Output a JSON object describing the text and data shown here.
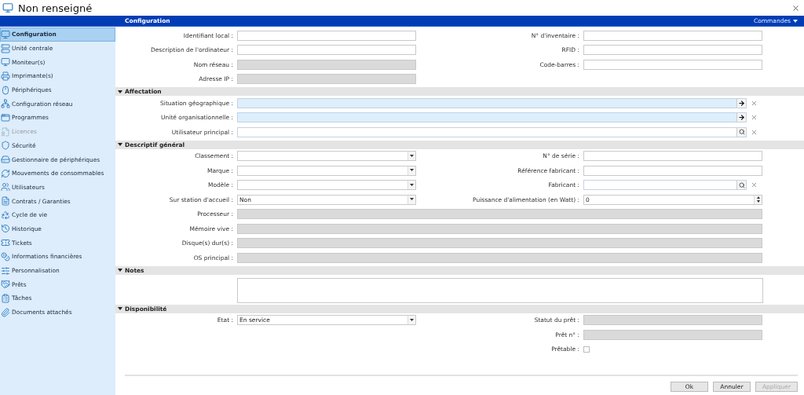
{
  "window": {
    "title": "Non renseigné"
  },
  "sidebar": {
    "items": [
      {
        "label": "Configuration",
        "selected": true,
        "disabled": false
      },
      {
        "label": "Unité centrale",
        "selected": false,
        "disabled": false
      },
      {
        "label": "Moniteur(s)",
        "selected": false,
        "disabled": false
      },
      {
        "label": "Imprimante(s)",
        "selected": false,
        "disabled": false
      },
      {
        "label": "Périphériques",
        "selected": false,
        "disabled": false
      },
      {
        "label": "Configuration réseau",
        "selected": false,
        "disabled": false
      },
      {
        "label": "Programmes",
        "selected": false,
        "disabled": false
      },
      {
        "label": "Licences",
        "selected": false,
        "disabled": true
      },
      {
        "label": "Sécurité",
        "selected": false,
        "disabled": false
      },
      {
        "label": "Gestionnaire de périphériques",
        "selected": false,
        "disabled": false
      },
      {
        "label": "Mouvements de consommables",
        "selected": false,
        "disabled": false
      },
      {
        "label": "Utilisateurs",
        "selected": false,
        "disabled": false
      },
      {
        "label": "Contrats / Garanties",
        "selected": false,
        "disabled": false
      },
      {
        "label": "Cycle de vie",
        "selected": false,
        "disabled": false
      },
      {
        "label": "Historique",
        "selected": false,
        "disabled": false
      },
      {
        "label": "Tickets",
        "selected": false,
        "disabled": false
      },
      {
        "label": "Informations financières",
        "selected": false,
        "disabled": false
      },
      {
        "label": "Personnalisation",
        "selected": false,
        "disabled": false
      },
      {
        "label": "Prêts",
        "selected": false,
        "disabled": false
      },
      {
        "label": "Tâches",
        "selected": false,
        "disabled": false
      },
      {
        "label": "Documents attachés",
        "selected": false,
        "disabled": false
      }
    ]
  },
  "header": {
    "title": "Configuration",
    "commands": "Commandes"
  },
  "main_rows": [
    {
      "left": {
        "label": "Identifiant local :",
        "kind": "text"
      },
      "right": {
        "label": "N° d'inventaire :",
        "kind": "text"
      }
    },
    {
      "left": {
        "label": "Description de l'ordinateur :",
        "kind": "text"
      },
      "right": {
        "label": "RFID :",
        "kind": "text"
      }
    },
    {
      "left": {
        "label": "Nom réseau :",
        "kind": "disabled"
      },
      "right": {
        "label": "Code-barres :",
        "kind": "text"
      }
    },
    {
      "left": {
        "label": "Adresse IP :",
        "kind": "disabled"
      }
    }
  ],
  "sections": [
    {
      "title": "Affectation",
      "expanded": true,
      "rows": [
        {
          "wide": {
            "label": "Situation géographique :",
            "kind": "lookup"
          }
        },
        {
          "wide": {
            "label": "Unité organisationnelle :",
            "kind": "lookup"
          }
        },
        {
          "wide": {
            "label": "Utilisateur principal :",
            "kind": "search"
          }
        }
      ]
    },
    {
      "title": "Descriptif général",
      "expanded": true,
      "rows": [
        {
          "left": {
            "label": "Classement :",
            "kind": "select"
          },
          "right": {
            "label": "N° de série :",
            "kind": "text"
          }
        },
        {
          "left": {
            "label": "Marque :",
            "kind": "select"
          },
          "right": {
            "label": "Référence fabricant :",
            "kind": "text"
          }
        },
        {
          "left": {
            "label": "Modèle :",
            "kind": "select"
          },
          "right": {
            "label": "Fabricant :",
            "kind": "search"
          }
        },
        {
          "left": {
            "label": "Sur station d'accueil :",
            "kind": "select",
            "value": "Non"
          },
          "right": {
            "label": "Puissance d'alimentation (en Watt) :",
            "kind": "spinner",
            "value": "0"
          }
        },
        {
          "wide": {
            "label": "Processeur :",
            "kind": "disabled"
          }
        },
        {
          "wide": {
            "label": "Mémoire vive :",
            "kind": "disabled"
          }
        },
        {
          "wide": {
            "label": "Disque(s) dur(s) :",
            "kind": "disabled"
          }
        },
        {
          "wide": {
            "label": "OS principal :",
            "kind": "disabled"
          }
        }
      ]
    },
    {
      "title": "Notes",
      "expanded": true,
      "rows": [
        {
          "wide": {
            "kind": "textarea"
          }
        }
      ]
    },
    {
      "title": "Disponibilité",
      "expanded": true,
      "rows": [
        {
          "left": {
            "label": "Etat :",
            "kind": "select",
            "value": "En service"
          },
          "right": {
            "label": "Statut du prêt :",
            "kind": "disabled"
          }
        },
        {
          "right": {
            "label": "Prêt n° :",
            "kind": "disabled"
          }
        },
        {
          "right": {
            "label": "Prêtable :",
            "kind": "checkbox",
            "checked": false
          }
        }
      ]
    }
  ],
  "buttons": [
    {
      "label": "Ok",
      "disabled": false
    },
    {
      "label": "Annuler",
      "disabled": false
    },
    {
      "label": "Appliquer",
      "disabled": true
    }
  ]
}
